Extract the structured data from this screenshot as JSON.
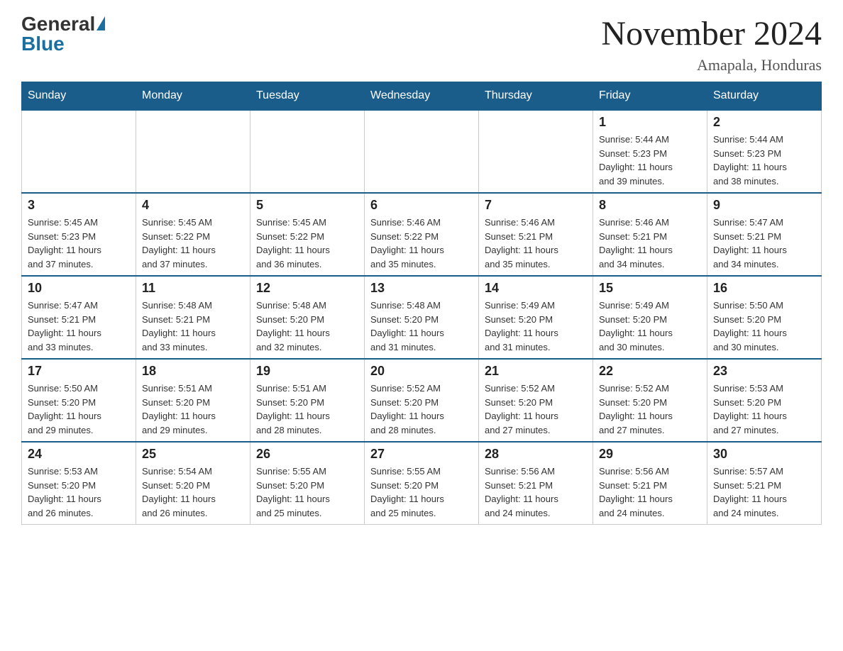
{
  "header": {
    "logo_general": "General",
    "logo_blue": "Blue",
    "title": "November 2024",
    "subtitle": "Amapala, Honduras"
  },
  "weekdays": [
    "Sunday",
    "Monday",
    "Tuesday",
    "Wednesday",
    "Thursday",
    "Friday",
    "Saturday"
  ],
  "weeks": [
    [
      {
        "day": "",
        "info": ""
      },
      {
        "day": "",
        "info": ""
      },
      {
        "day": "",
        "info": ""
      },
      {
        "day": "",
        "info": ""
      },
      {
        "day": "",
        "info": ""
      },
      {
        "day": "1",
        "info": "Sunrise: 5:44 AM\nSunset: 5:23 PM\nDaylight: 11 hours\nand 39 minutes."
      },
      {
        "day": "2",
        "info": "Sunrise: 5:44 AM\nSunset: 5:23 PM\nDaylight: 11 hours\nand 38 minutes."
      }
    ],
    [
      {
        "day": "3",
        "info": "Sunrise: 5:45 AM\nSunset: 5:23 PM\nDaylight: 11 hours\nand 37 minutes."
      },
      {
        "day": "4",
        "info": "Sunrise: 5:45 AM\nSunset: 5:22 PM\nDaylight: 11 hours\nand 37 minutes."
      },
      {
        "day": "5",
        "info": "Sunrise: 5:45 AM\nSunset: 5:22 PM\nDaylight: 11 hours\nand 36 minutes."
      },
      {
        "day": "6",
        "info": "Sunrise: 5:46 AM\nSunset: 5:22 PM\nDaylight: 11 hours\nand 35 minutes."
      },
      {
        "day": "7",
        "info": "Sunrise: 5:46 AM\nSunset: 5:21 PM\nDaylight: 11 hours\nand 35 minutes."
      },
      {
        "day": "8",
        "info": "Sunrise: 5:46 AM\nSunset: 5:21 PM\nDaylight: 11 hours\nand 34 minutes."
      },
      {
        "day": "9",
        "info": "Sunrise: 5:47 AM\nSunset: 5:21 PM\nDaylight: 11 hours\nand 34 minutes."
      }
    ],
    [
      {
        "day": "10",
        "info": "Sunrise: 5:47 AM\nSunset: 5:21 PM\nDaylight: 11 hours\nand 33 minutes."
      },
      {
        "day": "11",
        "info": "Sunrise: 5:48 AM\nSunset: 5:21 PM\nDaylight: 11 hours\nand 33 minutes."
      },
      {
        "day": "12",
        "info": "Sunrise: 5:48 AM\nSunset: 5:20 PM\nDaylight: 11 hours\nand 32 minutes."
      },
      {
        "day": "13",
        "info": "Sunrise: 5:48 AM\nSunset: 5:20 PM\nDaylight: 11 hours\nand 31 minutes."
      },
      {
        "day": "14",
        "info": "Sunrise: 5:49 AM\nSunset: 5:20 PM\nDaylight: 11 hours\nand 31 minutes."
      },
      {
        "day": "15",
        "info": "Sunrise: 5:49 AM\nSunset: 5:20 PM\nDaylight: 11 hours\nand 30 minutes."
      },
      {
        "day": "16",
        "info": "Sunrise: 5:50 AM\nSunset: 5:20 PM\nDaylight: 11 hours\nand 30 minutes."
      }
    ],
    [
      {
        "day": "17",
        "info": "Sunrise: 5:50 AM\nSunset: 5:20 PM\nDaylight: 11 hours\nand 29 minutes."
      },
      {
        "day": "18",
        "info": "Sunrise: 5:51 AM\nSunset: 5:20 PM\nDaylight: 11 hours\nand 29 minutes."
      },
      {
        "day": "19",
        "info": "Sunrise: 5:51 AM\nSunset: 5:20 PM\nDaylight: 11 hours\nand 28 minutes."
      },
      {
        "day": "20",
        "info": "Sunrise: 5:52 AM\nSunset: 5:20 PM\nDaylight: 11 hours\nand 28 minutes."
      },
      {
        "day": "21",
        "info": "Sunrise: 5:52 AM\nSunset: 5:20 PM\nDaylight: 11 hours\nand 27 minutes."
      },
      {
        "day": "22",
        "info": "Sunrise: 5:52 AM\nSunset: 5:20 PM\nDaylight: 11 hours\nand 27 minutes."
      },
      {
        "day": "23",
        "info": "Sunrise: 5:53 AM\nSunset: 5:20 PM\nDaylight: 11 hours\nand 27 minutes."
      }
    ],
    [
      {
        "day": "24",
        "info": "Sunrise: 5:53 AM\nSunset: 5:20 PM\nDaylight: 11 hours\nand 26 minutes."
      },
      {
        "day": "25",
        "info": "Sunrise: 5:54 AM\nSunset: 5:20 PM\nDaylight: 11 hours\nand 26 minutes."
      },
      {
        "day": "26",
        "info": "Sunrise: 5:55 AM\nSunset: 5:20 PM\nDaylight: 11 hours\nand 25 minutes."
      },
      {
        "day": "27",
        "info": "Sunrise: 5:55 AM\nSunset: 5:20 PM\nDaylight: 11 hours\nand 25 minutes."
      },
      {
        "day": "28",
        "info": "Sunrise: 5:56 AM\nSunset: 5:21 PM\nDaylight: 11 hours\nand 24 minutes."
      },
      {
        "day": "29",
        "info": "Sunrise: 5:56 AM\nSunset: 5:21 PM\nDaylight: 11 hours\nand 24 minutes."
      },
      {
        "day": "30",
        "info": "Sunrise: 5:57 AM\nSunset: 5:21 PM\nDaylight: 11 hours\nand 24 minutes."
      }
    ]
  ]
}
